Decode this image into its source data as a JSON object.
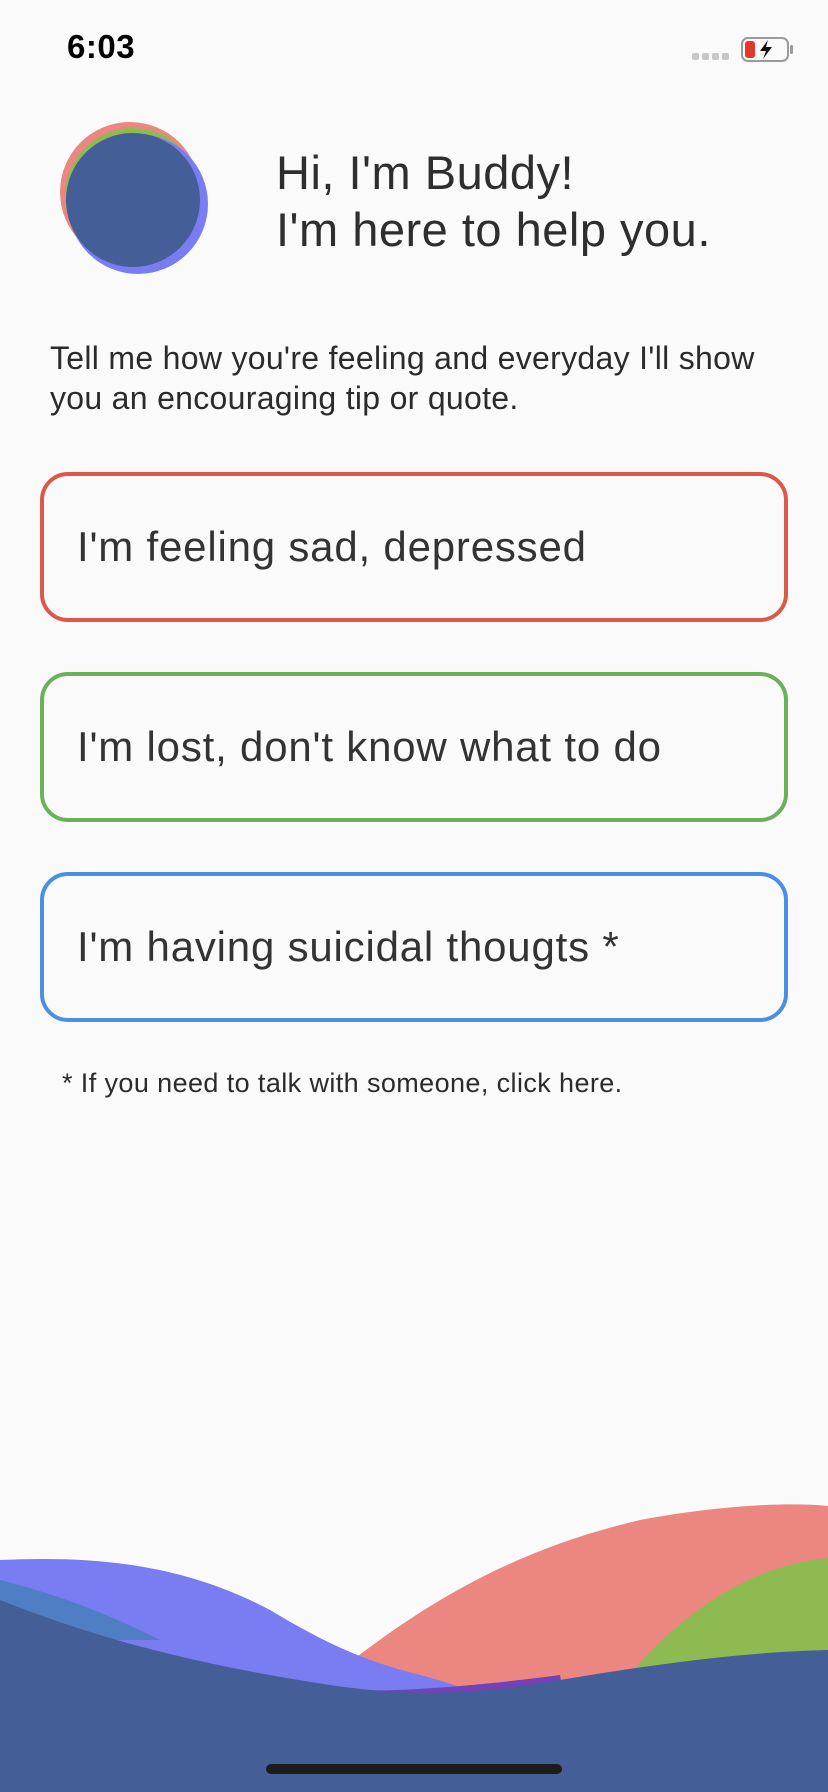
{
  "status_bar": {
    "time": "6:03",
    "signal_icon": "cellular-signal-icon",
    "battery_icon": "battery-charging-icon"
  },
  "header": {
    "avatar_icon": "buddy-avatar-icon",
    "greeting_line1": "Hi, I'm Buddy!",
    "greeting_line2": "I'm here to help you."
  },
  "intro_text": "Tell me how you're feeling and everyday I'll show you an encouraging tip or quote.",
  "options": [
    {
      "label": "I'm feeling sad, depressed",
      "color": "#dc5849"
    },
    {
      "label": "I'm lost, don't know what to do",
      "color": "#6ab15c"
    },
    {
      "label": "I'm having suicidal thougts *",
      "color": "#4a90e2"
    }
  ],
  "footnote": "* If you need to talk with someone, click here.",
  "colors": {
    "background": "#fafafa",
    "wave_red": "#ec8680",
    "wave_green": "#8eba52",
    "wave_blue": "#7a7cf2",
    "wave_navy": "#445e98",
    "wave_purple": "#7441b8"
  }
}
